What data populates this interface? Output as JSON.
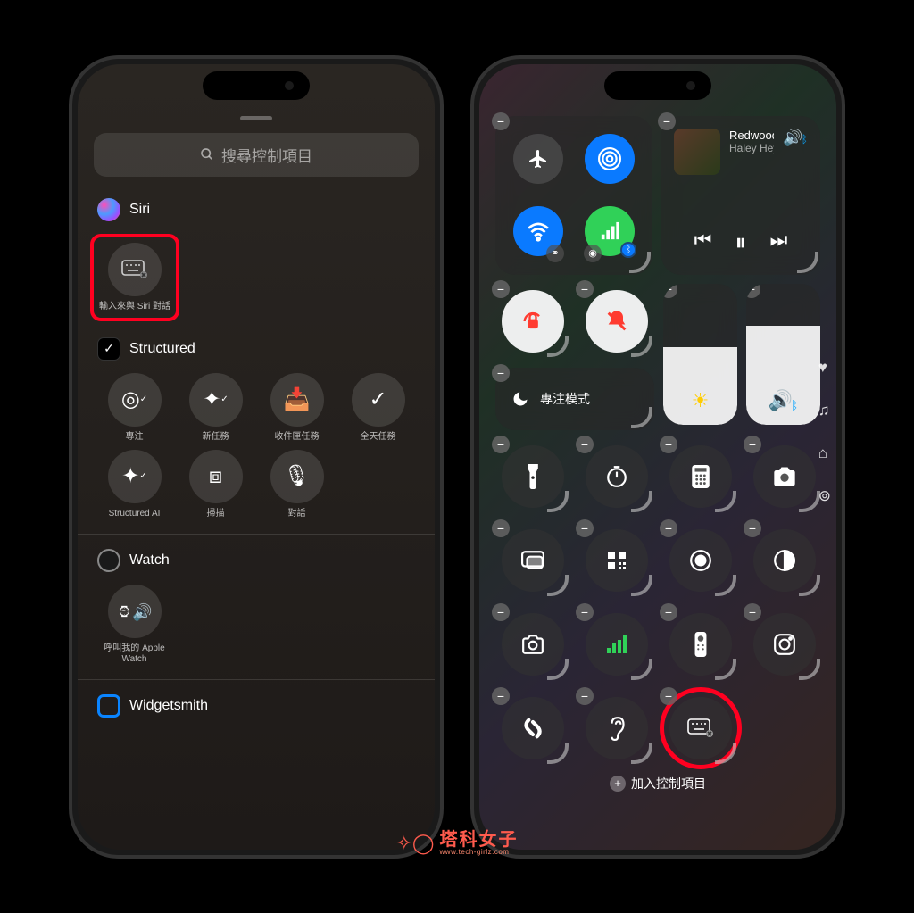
{
  "search": {
    "placeholder": "搜尋控制項目"
  },
  "sections": {
    "siri": {
      "title": "Siri",
      "type_to_siri": "輸入來與 Siri 對話"
    },
    "structured": {
      "title": "Structured",
      "items": [
        "專注",
        "新任務",
        "收件匣任務",
        "全天任務",
        "Structured AI",
        "掃描",
        "對話"
      ]
    },
    "watch": {
      "title": "Watch",
      "ping": "呼叫我的 Apple Watch"
    },
    "widgetsmith": {
      "title": "Widgetsmith"
    }
  },
  "cc": {
    "media": {
      "title": "Redwoods (Anxious)",
      "artist": "Haley Heynderickx"
    },
    "focus": "專注模式",
    "add_control": "加入控制項目"
  },
  "watermark": {
    "text": "塔科女子",
    "url": "www.tech-girlz.com"
  }
}
